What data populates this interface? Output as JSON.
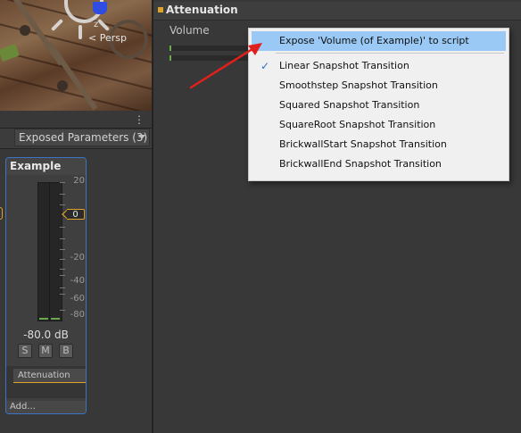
{
  "scene": {
    "camera_label": "< Persp",
    "axis_label": "z"
  },
  "left_panel": {
    "exposed_parameters_label": "Exposed Parameters (3)",
    "kebab_icon": "vertical-ellipsis-icon"
  },
  "channel_strip": {
    "title": "Example",
    "scale_labels": [
      "20",
      "0",
      "-20",
      "-40",
      "-60",
      "-80"
    ],
    "fader_value": "0",
    "db_readout": "-80.0 dB",
    "solo_label": "S",
    "mute_label": "M",
    "bypass_label": "B",
    "effect": "Attenuation",
    "add_label": "Add..."
  },
  "inspector": {
    "section_title": "Attenuation",
    "volume_label": "Volume"
  },
  "context_menu": {
    "items": [
      {
        "label": "Expose 'Volume (of Example)' to script",
        "highlighted": true,
        "checked": false
      },
      {
        "label": "Linear Snapshot Transition",
        "highlighted": false,
        "checked": true
      },
      {
        "label": "Smoothstep Snapshot Transition",
        "highlighted": false,
        "checked": false
      },
      {
        "label": "Squared Snapshot Transition",
        "highlighted": false,
        "checked": false
      },
      {
        "label": "SquareRoot Snapshot Transition",
        "highlighted": false,
        "checked": false
      },
      {
        "label": "BrickwallStart Snapshot Transition",
        "highlighted": false,
        "checked": false
      },
      {
        "label": "BrickwallEnd Snapshot Transition",
        "highlighted": false,
        "checked": false
      }
    ],
    "check_glyph": "✓"
  },
  "colors": {
    "highlight": "#99c9f4",
    "accent_orange": "#e0a32a",
    "selection_blue": "#3b74c4",
    "annotation_red": "#e0201c"
  }
}
